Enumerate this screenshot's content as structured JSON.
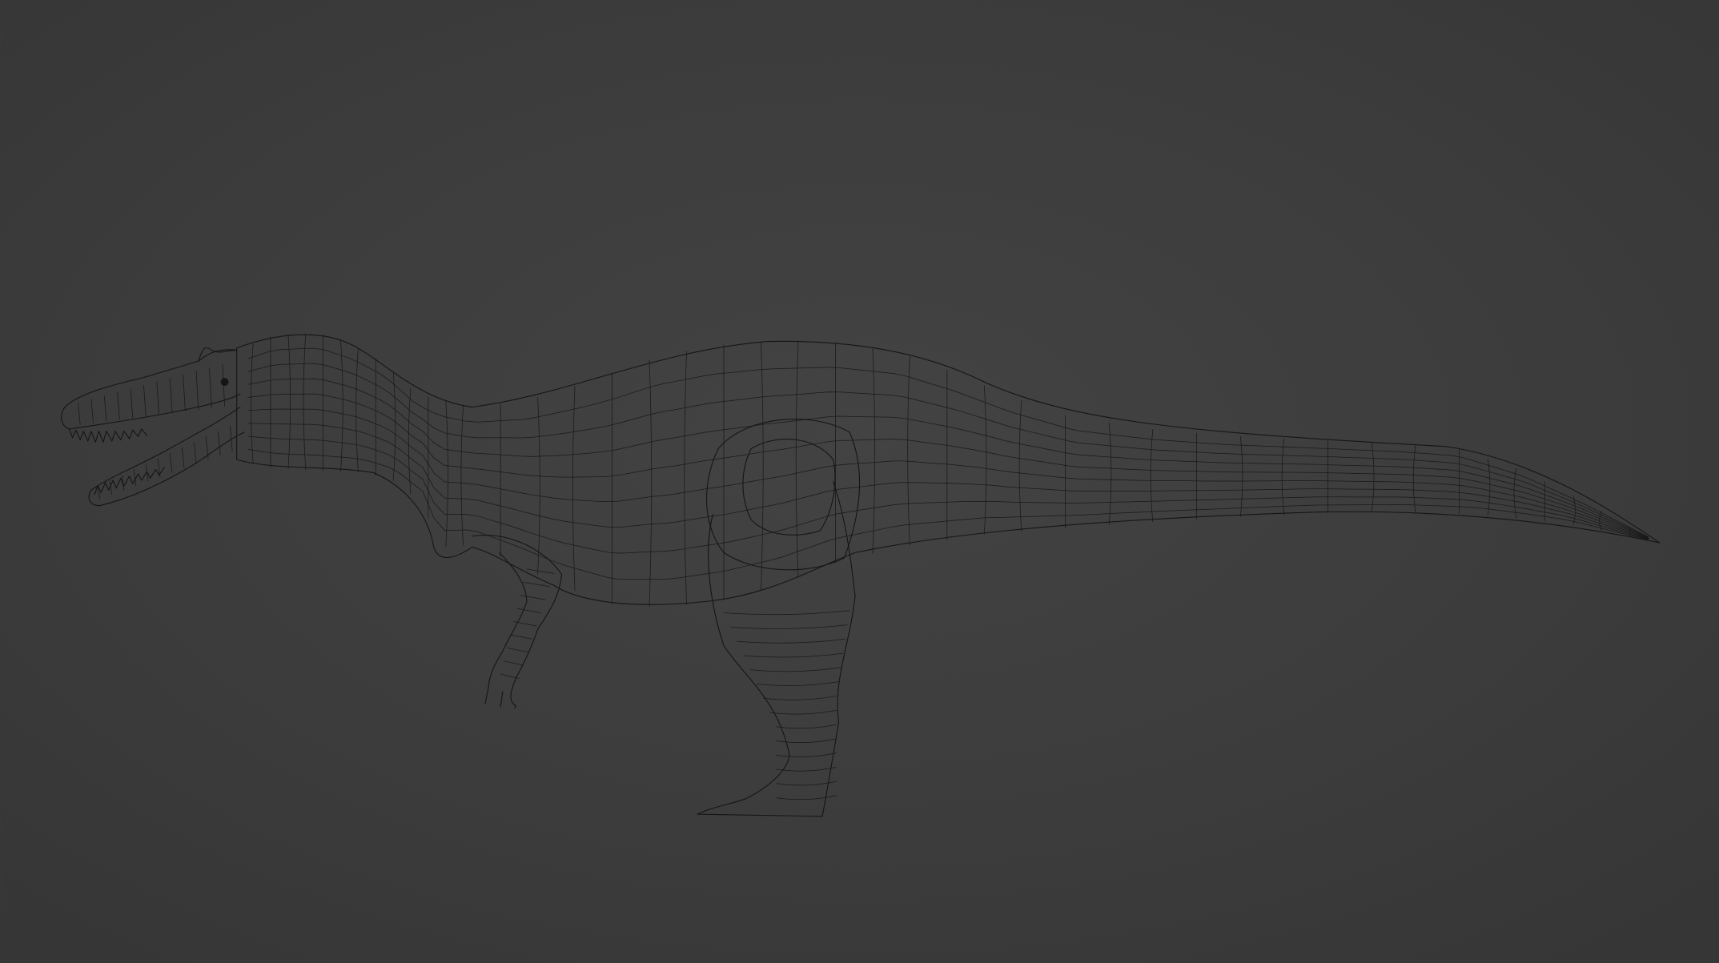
{
  "scene": {
    "background_color": "#3d3d3d",
    "wire_color": "#151515",
    "subject": "wireframe-dinosaur-model"
  }
}
